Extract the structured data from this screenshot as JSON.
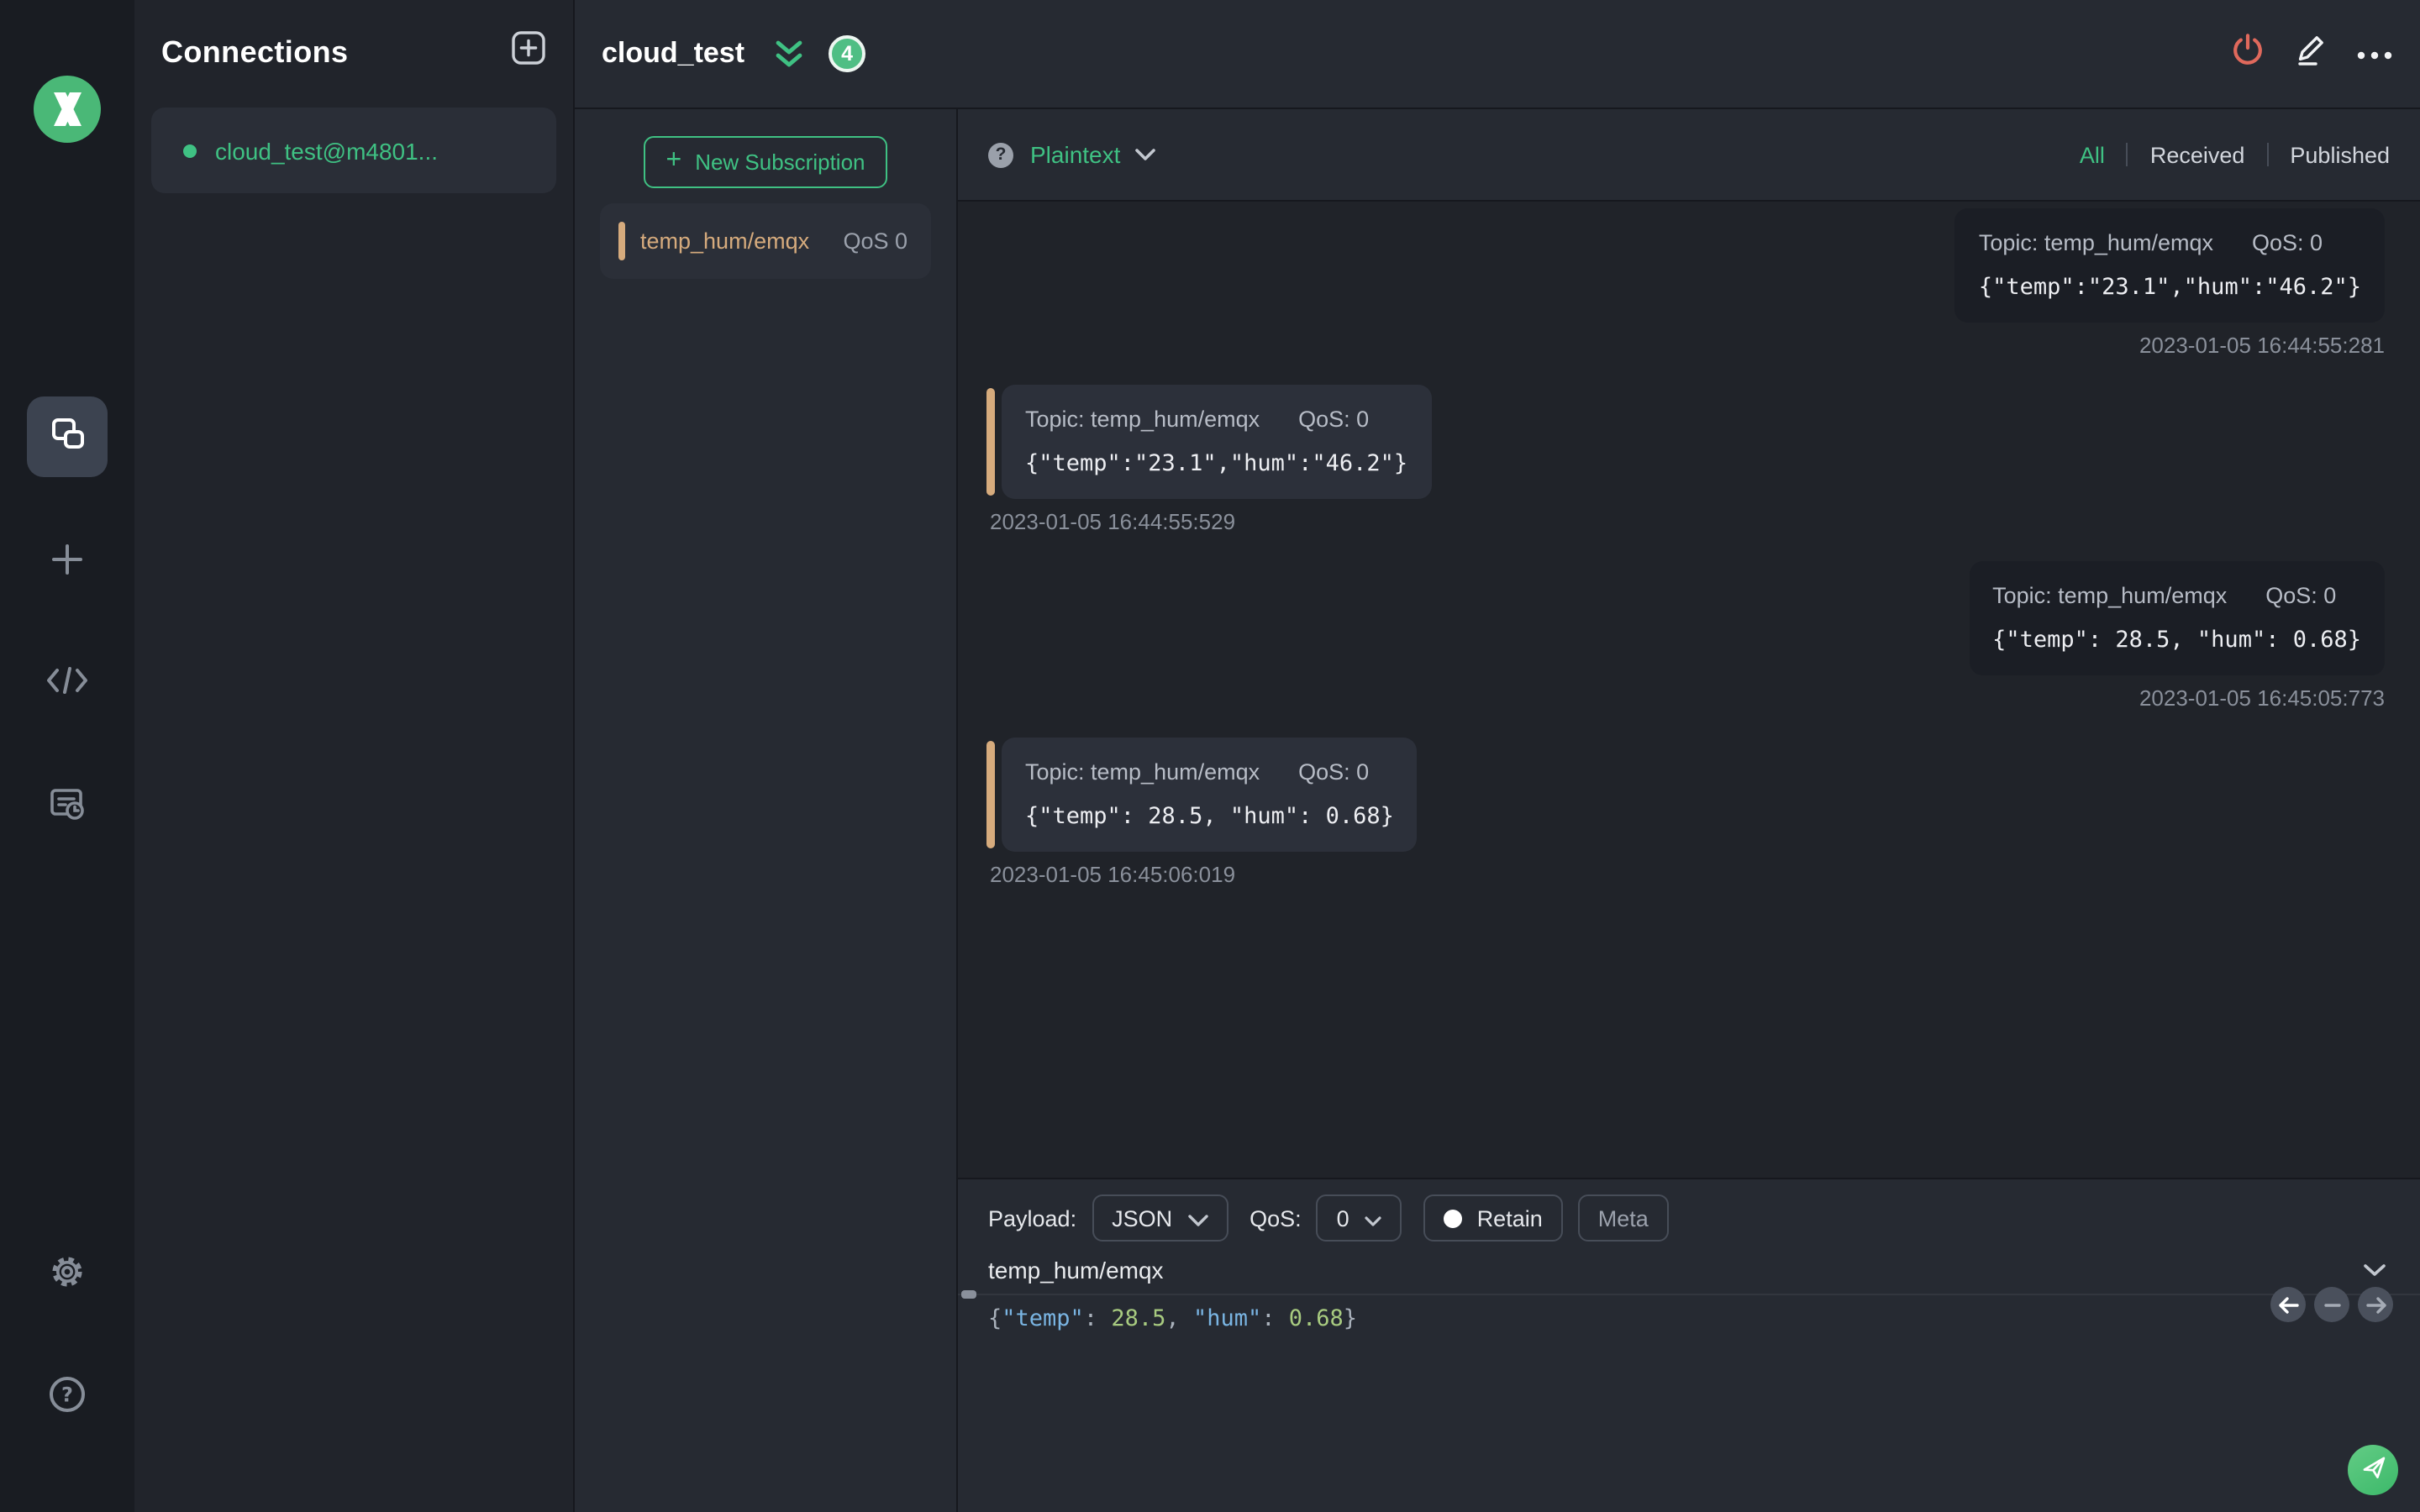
{
  "colors": {
    "accent_green": "#3fc183",
    "badge_green": "#4fbe84",
    "danger_red": "#e0695c",
    "topic_tan": "#d6ab7d",
    "code_key_blue": "#7ab5e3",
    "code_number_green": "#a8cb80"
  },
  "rail": {
    "logo_name": "mqttx-logo",
    "icons": [
      "connections",
      "new-connection",
      "script",
      "log",
      "settings",
      "help"
    ]
  },
  "connections_panel": {
    "title": "Connections",
    "add_icon": "plus-square",
    "items": [
      {
        "label": "cloud_test@m4801...",
        "status": "connected"
      }
    ]
  },
  "topbar": {
    "title": "cloud_test",
    "unread_badge": "4",
    "icons": [
      "collapse-double-chevron",
      "disconnect-power",
      "edit-pencil",
      "more-ellipsis"
    ]
  },
  "subscriptions": {
    "new_button_label": "New Subscription",
    "items": [
      {
        "topic": "temp_hum/emqx",
        "qos": "QoS 0"
      }
    ]
  },
  "messages_view": {
    "format_value": "Plaintext",
    "help_icon": "help-circle",
    "filters": [
      {
        "label": "All",
        "active": true
      },
      {
        "label": "Received",
        "active": false
      },
      {
        "label": "Published",
        "active": false
      }
    ],
    "messages": [
      {
        "direction": "published",
        "topic_label": "Topic: temp_hum/emqx",
        "qos_label": "QoS: 0",
        "payload": "{\"temp\":\"23.1\",\"hum\":\"46.2\"}",
        "timestamp": "2023-01-05 16:44:55:281"
      },
      {
        "direction": "received",
        "topic_label": "Topic: temp_hum/emqx",
        "qos_label": "QoS: 0",
        "payload": "{\"temp\":\"23.1\",\"hum\":\"46.2\"}",
        "timestamp": "2023-01-05 16:44:55:529"
      },
      {
        "direction": "published",
        "topic_label": "Topic: temp_hum/emqx",
        "qos_label": "QoS: 0",
        "payload": "{\"temp\": 28.5, \"hum\": 0.68}",
        "timestamp": "2023-01-05 16:45:05:773"
      },
      {
        "direction": "received",
        "topic_label": "Topic: temp_hum/emqx",
        "qos_label": "QoS: 0",
        "payload": "{\"temp\": 28.5, \"hum\": 0.68}",
        "timestamp": "2023-01-05 16:45:06:019"
      }
    ]
  },
  "publish": {
    "payload_label": "Payload:",
    "payload_format": "JSON",
    "qos_label": "QoS:",
    "qos_value": "0",
    "retain_label": "Retain",
    "meta_label": "Meta",
    "topic_value": "temp_hum/emqx",
    "editor_tokens": [
      {
        "text": "{",
        "type": "punc"
      },
      {
        "text": "\"temp\"",
        "type": "key"
      },
      {
        "text": ": ",
        "type": "punc"
      },
      {
        "text": "28.5",
        "type": "num"
      },
      {
        "text": ", ",
        "type": "punc"
      },
      {
        "text": "\"hum\"",
        "type": "key"
      },
      {
        "text": ": ",
        "type": "punc"
      },
      {
        "text": "0.68",
        "type": "num"
      },
      {
        "text": "}",
        "type": "punc"
      }
    ],
    "nav_buttons": [
      "previous-message",
      "remove-message",
      "next-message"
    ],
    "send_icon": "paper-plane"
  }
}
